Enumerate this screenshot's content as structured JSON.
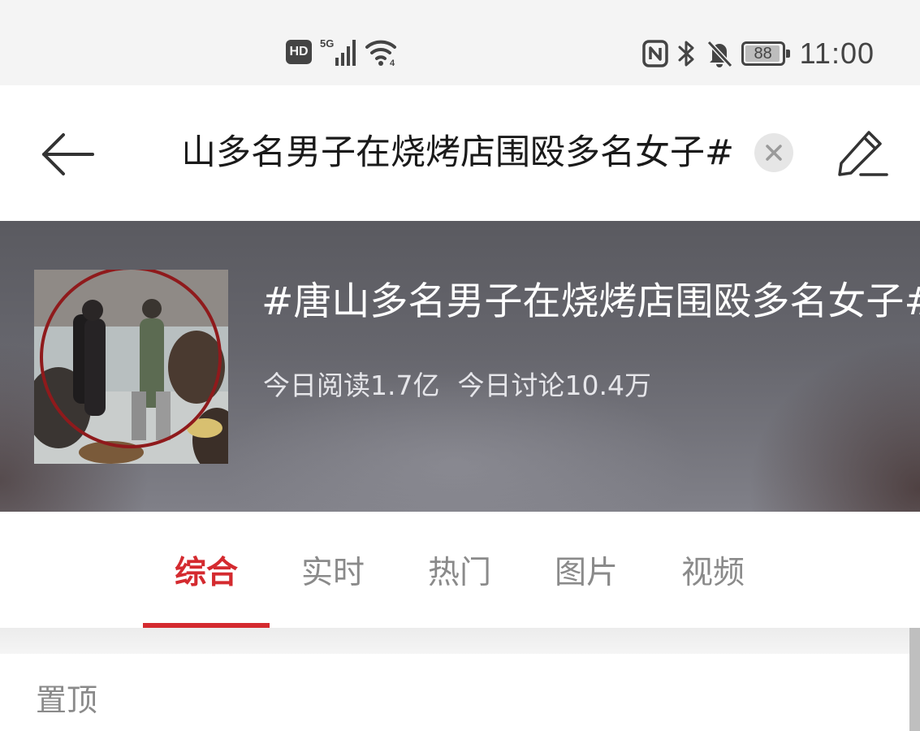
{
  "status_bar": {
    "hd_badge": "HD",
    "network": "5G",
    "battery_level": "88",
    "time": "11:00",
    "icons": [
      "hd-icon",
      "signal-icon",
      "wifi-icon",
      "nfc-icon",
      "bluetooth-icon",
      "mute-icon",
      "battery-icon"
    ]
  },
  "header": {
    "search_query": "#唐山多名男子在烧烤店围殴多名女子#",
    "icons": [
      "back-arrow-icon",
      "clear-icon",
      "edit-icon"
    ]
  },
  "topic": {
    "title": "#唐山多名男子在烧烤店围殴多名女子#",
    "reads_today": "今日阅读1.7亿",
    "discussions_today": "今日讨论10.4万"
  },
  "tabs": [
    {
      "label": "综合",
      "active": true
    },
    {
      "label": "实时",
      "active": false
    },
    {
      "label": "热门",
      "active": false
    },
    {
      "label": "图片",
      "active": false
    },
    {
      "label": "视频",
      "active": false
    }
  ],
  "pinned": {
    "label": "置顶"
  },
  "colors": {
    "accent": "#d42a2f",
    "tab_inactive": "#8a8a8a",
    "status_bar_bg": "#f4f4f4"
  }
}
